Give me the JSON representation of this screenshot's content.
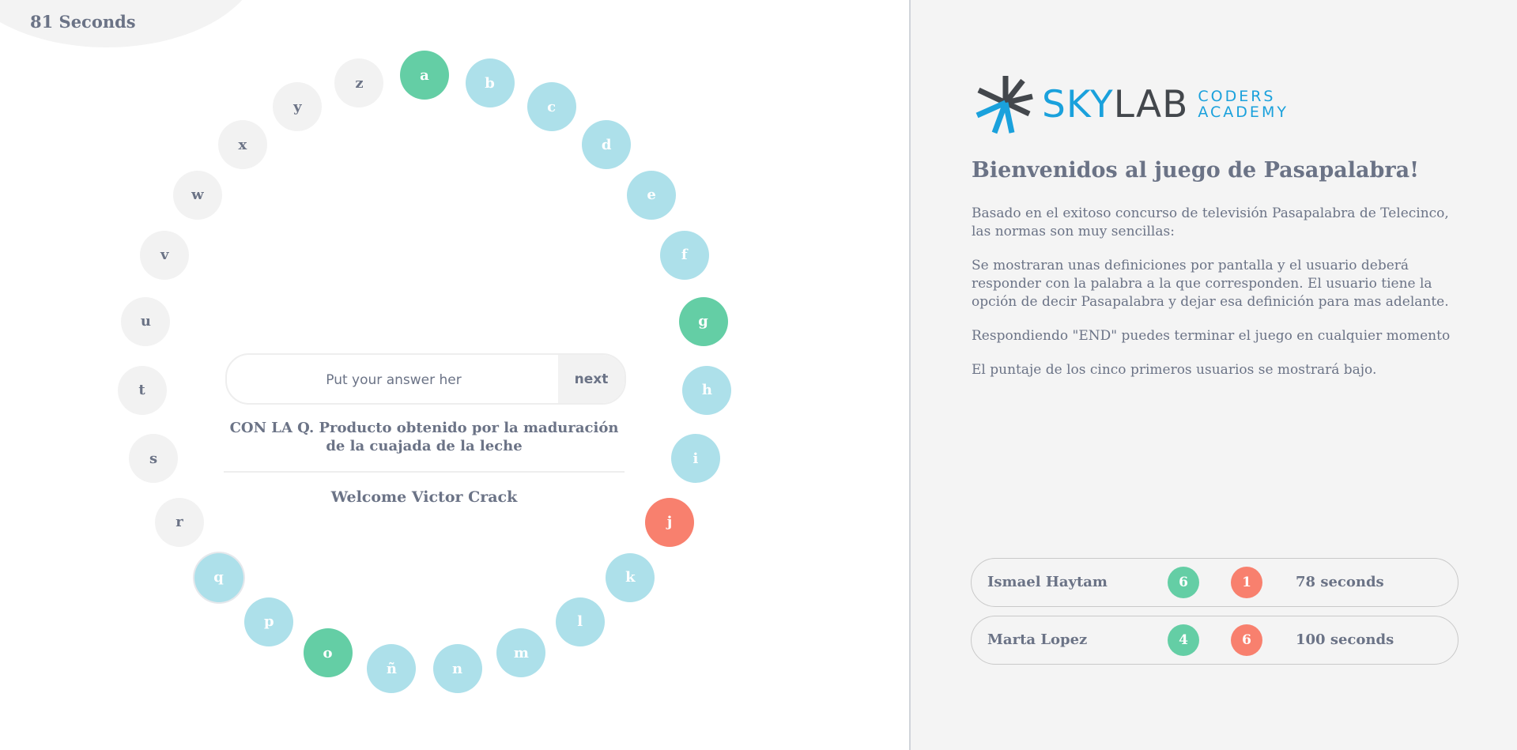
{
  "timer": {
    "label": "81 Seconds"
  },
  "rosco": [
    {
      "letter": "a",
      "status": "correct"
    },
    {
      "letter": "b",
      "status": "pending"
    },
    {
      "letter": "c",
      "status": "pending"
    },
    {
      "letter": "d",
      "status": "pending"
    },
    {
      "letter": "e",
      "status": "pending"
    },
    {
      "letter": "f",
      "status": "pending"
    },
    {
      "letter": "g",
      "status": "correct"
    },
    {
      "letter": "h",
      "status": "pending"
    },
    {
      "letter": "i",
      "status": "pending"
    },
    {
      "letter": "j",
      "status": "wrong"
    },
    {
      "letter": "k",
      "status": "pending"
    },
    {
      "letter": "l",
      "status": "pending"
    },
    {
      "letter": "m",
      "status": "pending"
    },
    {
      "letter": "n",
      "status": "pending"
    },
    {
      "letter": "ñ",
      "status": "pending"
    },
    {
      "letter": "o",
      "status": "correct"
    },
    {
      "letter": "p",
      "status": "pending"
    },
    {
      "letter": "q",
      "status": "current"
    },
    {
      "letter": "r",
      "status": "unseen"
    },
    {
      "letter": "s",
      "status": "unseen"
    },
    {
      "letter": "t",
      "status": "unseen"
    },
    {
      "letter": "u",
      "status": "unseen"
    },
    {
      "letter": "v",
      "status": "unseen"
    },
    {
      "letter": "w",
      "status": "unseen"
    },
    {
      "letter": "x",
      "status": "unseen"
    },
    {
      "letter": "y",
      "status": "unseen"
    },
    {
      "letter": "z",
      "status": "unseen"
    }
  ],
  "answer": {
    "placeholder": "Put your answer her",
    "value": "",
    "next_label": "next"
  },
  "question": "CON LA Q. Producto obtenido por la maduración de la cuajada de la leche",
  "welcome": "Welcome Victor Crack",
  "brand": {
    "sky": "SKY",
    "lab": "LAB",
    "sub_line1": "CODERS",
    "sub_line2": "ACADEMY"
  },
  "intro": {
    "title": "Bienvenidos al juego de Pasapalabra!",
    "paragraphs": [
      "Basado en el exitoso concurso de televisión Pasapalabra de Telecinco, las normas son muy sencillas:",
      "Se mostraran unas definiciones por pantalla y el usuario deberá responder con la palabra a la que corresponden. El usuario tiene la opción de decir Pasapalabra y dejar esa definición para mas adelante.",
      "Respondiendo \"END\" puedes terminar el juego en cualquier momento",
      "El puntaje de los cinco primeros usuarios se mostrará bajo."
    ]
  },
  "scores": [
    {
      "name": "Ismael Haytam",
      "correct": "6",
      "wrong": "1",
      "time": "78 seconds"
    },
    {
      "name": "Marta Lopez",
      "correct": "4",
      "wrong": "6",
      "time": "100 seconds"
    }
  ],
  "colors": {
    "correct": "#64cea5",
    "wrong": "#f8806e",
    "pending": "#ade0ea",
    "unseen": "#f2f2f2",
    "text": "#6b7386",
    "brand_blue": "#1aa1dc",
    "brand_dark": "#43474c"
  }
}
